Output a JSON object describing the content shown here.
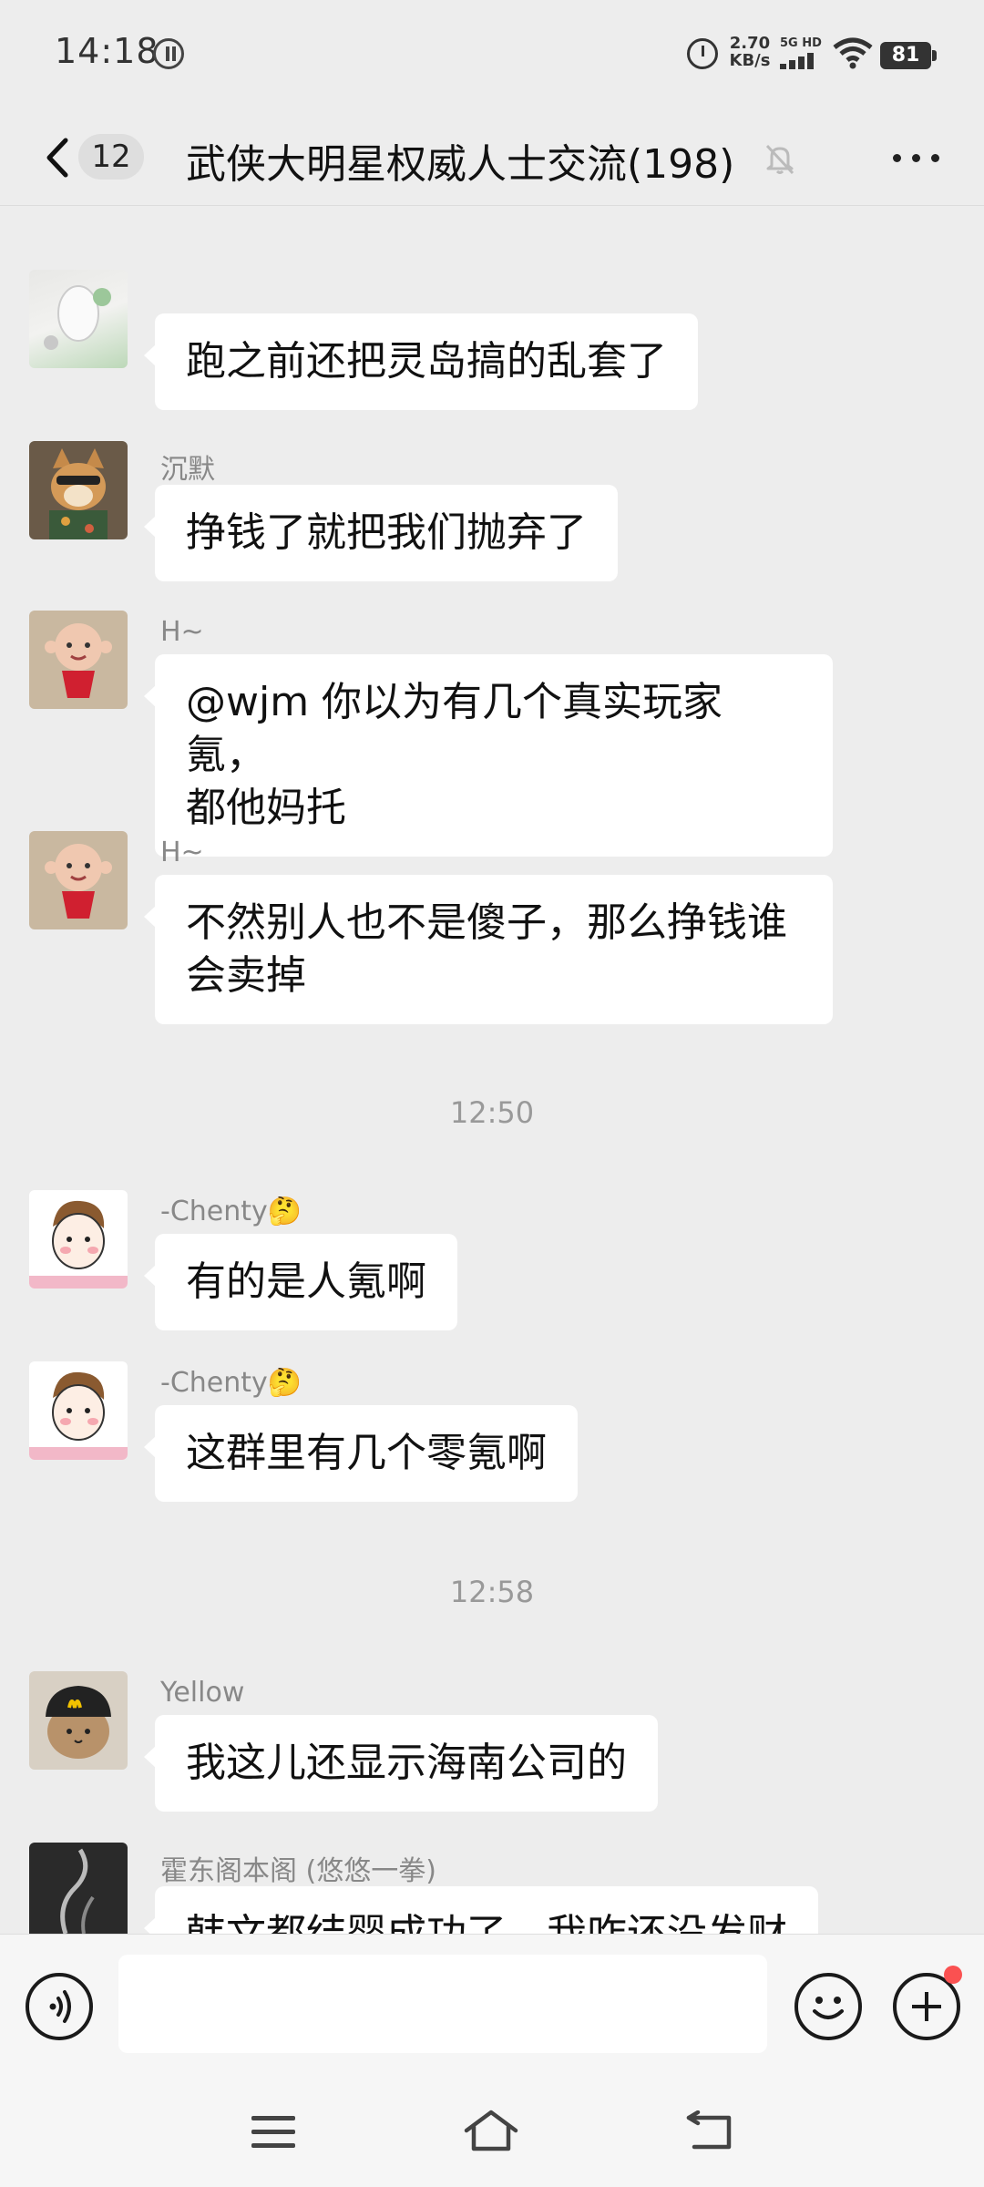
{
  "status_bar": {
    "time": "14:18",
    "net_speed_value": "2.70",
    "net_speed_unit": "KB/s",
    "network_tag": "5G HD",
    "battery": "81"
  },
  "header": {
    "unread_count": "12",
    "title": "武侠大明星权威人士交流(198)"
  },
  "messages": [
    {
      "sender": "",
      "text_lines": [
        "跑之前还把灵岛搞的乱套了"
      ],
      "avatar": "figurine-avatar"
    },
    {
      "sender": "沉默",
      "text_lines": [
        "挣钱了就把我们抛弃了"
      ],
      "avatar": "shiba-dog-avatar"
    },
    {
      "sender": "H~",
      "text_lines": [
        "@wjm  你以为有几个真实玩家氪，",
        "都他妈托"
      ],
      "avatar": "cartoon-doll-avatar"
    },
    {
      "sender": "H~",
      "text_lines": [
        "不然别人也不是傻子，那么挣钱谁",
        "会卖掉"
      ],
      "avatar": "cartoon-doll-avatar"
    },
    {
      "sender": "-Chenty🤔",
      "text_lines": [
        "有的是人氪啊"
      ],
      "avatar": "cartoon-boy-avatar"
    },
    {
      "sender": "-Chenty🤔",
      "text_lines": [
        "这群里有几个零氪啊"
      ],
      "avatar": "cartoon-boy-avatar"
    },
    {
      "sender": "Yellow",
      "text_lines": [
        "我这儿还显示海南公司的"
      ],
      "avatar": "mcdonalds-cap-avatar"
    },
    {
      "sender": "霍东阁本阁 (悠悠一拳)",
      "text_lines": [
        "韩文都结婴成功了，我咋还没发财"
      ],
      "avatar": "smoke-avatar"
    }
  ],
  "timestamps": [
    "12:50",
    "12:58"
  ],
  "input": {
    "placeholder": ""
  },
  "colors": {
    "background": "#ededed",
    "bubble": "#ffffff",
    "badge_red": "#fa5151"
  }
}
